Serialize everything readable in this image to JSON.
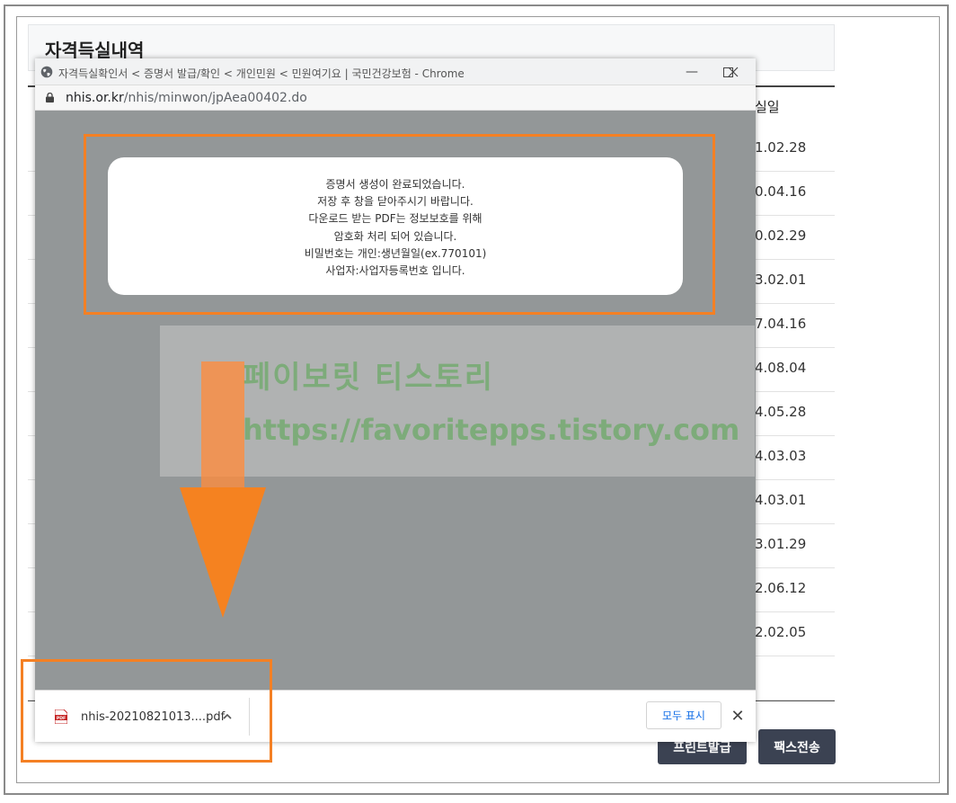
{
  "background_page": {
    "title": "자격득실내역",
    "column_header_partial": "실일",
    "dates": [
      "1.02.28",
      "0.04.16",
      "0.02.29",
      "3.02.01",
      "7.04.16",
      "4.08.04",
      "4.05.28",
      "4.03.03",
      "4.03.01",
      "3.01.29",
      "2.06.12",
      "2.02.05"
    ],
    "buttons": {
      "print": "프린트발급",
      "fax": "팩스전송"
    }
  },
  "popup": {
    "window_title": "자격득실확인서 < 증명서 발급/확인 < 개인민원 < 민원여기요 | 국민건강보험 - Chrome",
    "window_controls": {
      "minimize": "—",
      "maximize": "☐",
      "close": "✕"
    },
    "url_domain": "nhis.or.kr",
    "url_path": "/nhis/minwon/jpAea00402.do",
    "message": {
      "lines": [
        "증명서 생성이 완료되었습니다.",
        "저장 후 창을 닫아주시기 바랍니다.",
        "다운로드 받는 PDF는 정보보호를 위해",
        "암호화 처리 되어 있습니다.",
        "비밀번호는 개인:생년월일(ex.770101)",
        "사업자:사업자등록번호 입니다."
      ]
    },
    "download_shelf": {
      "file_name": "nhis-20210821013....pdf",
      "file_type_label": "PDF",
      "show_all": "모두 표시",
      "close_glyph": "✕"
    }
  },
  "watermark": {
    "line1": "페이보릿 티스토리",
    "line2": "https://favoritepps.tistory.com"
  },
  "colors": {
    "highlight": "#f48024",
    "popup_bg": "#939798",
    "button_dark": "#3b4252",
    "watermark_text": "#78aa73"
  }
}
